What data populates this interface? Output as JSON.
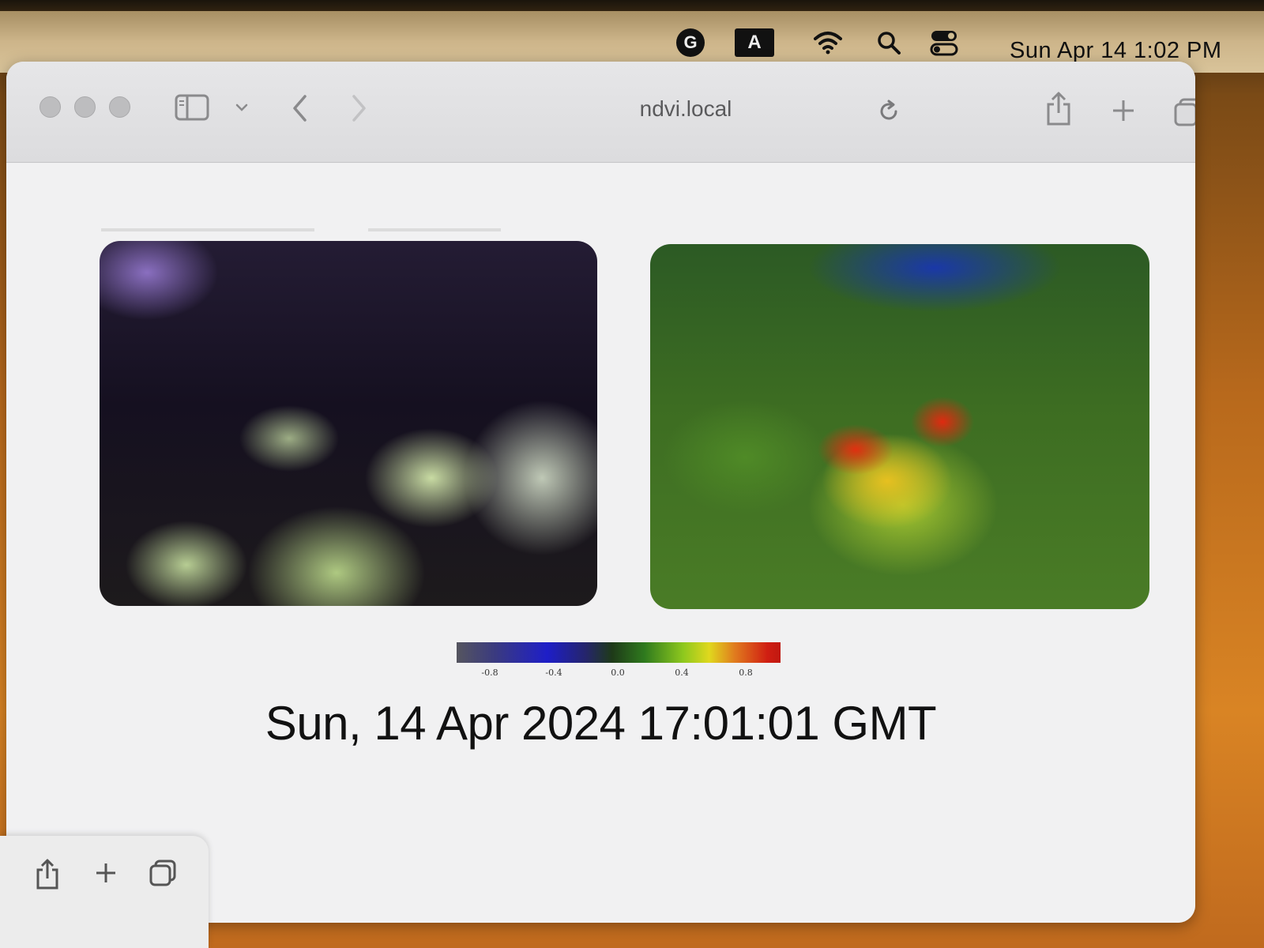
{
  "menubar": {
    "clock": "Sun Apr 14  1:02 PM",
    "input_source": "A",
    "grammarly_letter": "G",
    "icons": [
      "grammarly-icon",
      "input-source-icon",
      "wifi-icon",
      "spotlight-search-icon",
      "control-center-icon"
    ]
  },
  "browser": {
    "url": "ndvi.local",
    "toolbar_icons": [
      "sidebar-icon",
      "chevron-down-icon",
      "back-icon",
      "forward-icon",
      "reload-icon",
      "share-icon",
      "new-tab-icon",
      "tab-overview-icon"
    ]
  },
  "page": {
    "colorbar_ticks": [
      "-0.8",
      "-0.4",
      "0.0",
      "0.4",
      "0.8"
    ],
    "timestamp": "Sun, 14 Apr 2024 17:01:01 GMT"
  },
  "tab_overlay": {
    "icons": [
      "share-icon",
      "new-tab-icon",
      "tab-overview-icon"
    ]
  }
}
